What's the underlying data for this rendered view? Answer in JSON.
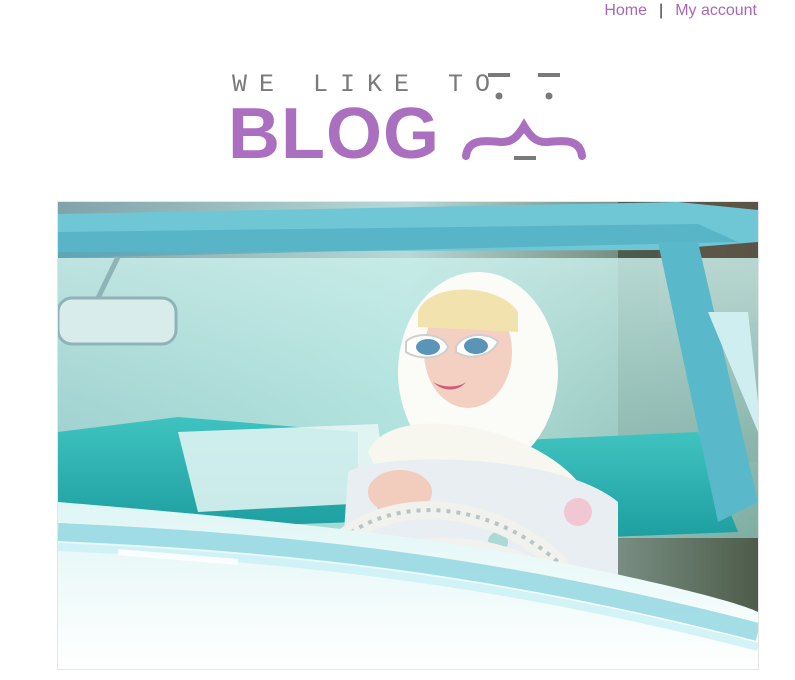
{
  "nav": {
    "home_label": "Home",
    "separator": "|",
    "account_label": "My account"
  },
  "logo": {
    "tagline": "WE LIKE TO",
    "brand": "BLOG"
  },
  "colors": {
    "accent": "#ab6fbf",
    "link": "#a768b5",
    "tagline": "#7a7a7a"
  },
  "icons": {
    "logo_face": "face-icon"
  }
}
